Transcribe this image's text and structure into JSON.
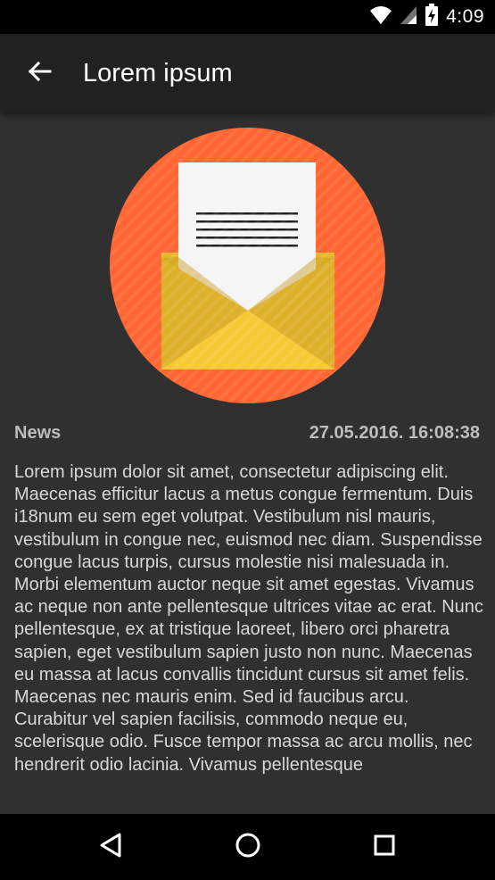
{
  "status_bar": {
    "time": "4:09",
    "icons": [
      "wifi-icon",
      "signal-icon",
      "battery-charging-icon"
    ]
  },
  "app_bar": {
    "title": "Lorem ipsum",
    "back_icon": "arrow-back-icon"
  },
  "article": {
    "hero_icon": "envelope-letter-icon",
    "category": "News",
    "datetime": "27.05.2016. 16:08:38",
    "body": "Lorem ipsum dolor sit amet, consectetur adipiscing elit. Maecenas efficitur lacus a metus congue fermentum. Duis i18num eu sem eget volutpat. Vestibulum nisl mauris, vestibulum in congue nec, euismod nec diam. Suspendisse congue lacus turpis, cursus molestie nisi malesuada in. Morbi elementum auctor neque sit amet egestas. Vivamus ac neque non ante pellentesque ultrices vitae ac erat. Nunc pellentesque, ex at tristique laoreet, libero orci pharetra sapien, eget vestibulum sapien justo non nunc. Maecenas eu massa at lacus convallis tincidunt cursus sit amet felis. Maecenas nec mauris enim. Sed id faucibus arcu.\nCurabitur vel sapien facilisis, commodo neque eu, scelerisque odio. Fusce tempor massa ac arcu mollis, nec hendrerit odio lacinia. Vivamus pellentesque"
  },
  "nav_bar": {
    "icons": [
      "back-triangle-icon",
      "home-circle-icon",
      "recents-square-icon"
    ]
  },
  "colors": {
    "status_bar": "#000000",
    "app_bar": "#212121",
    "background": "#303030",
    "circle": "#FF6633",
    "envelope": "#F2C230",
    "letter": "#F5F5F5",
    "meta_text": "#BDBDBD",
    "body_text": "#D7D7D7"
  }
}
